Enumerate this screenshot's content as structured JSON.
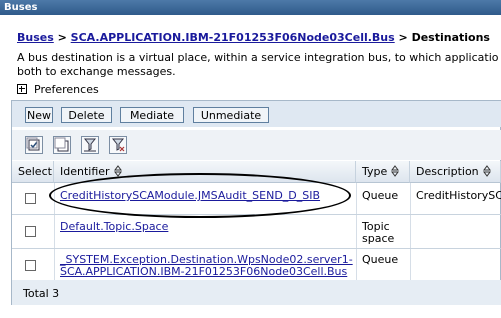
{
  "titlebar": {
    "title": "Buses"
  },
  "breadcrumb": {
    "link1": "Buses",
    "sep1": " > ",
    "link2": "SCA.APPLICATION.IBM-21F01253F06Node03Cell.Bus",
    "sep2": " > ",
    "current": "Destinations"
  },
  "description": {
    "line1": "A bus destination is a virtual place, within a service integration bus, to which applicatio",
    "line2": "both to exchange messages."
  },
  "preferences": {
    "label": "Preferences"
  },
  "toolbar": {
    "new_label": "New",
    "delete_label": "Delete",
    "mediate_label": "Mediate",
    "unmediate_label": "Unmediate"
  },
  "icons": [
    "select-all-icon",
    "deselect-all-icon",
    "show-filter-icon",
    "clear-filter-icon"
  ],
  "table": {
    "headers": {
      "select": "Select",
      "identifier": "Identifier",
      "type": "Type",
      "description": "Description"
    },
    "rows": [
      {
        "identifier": "CreditHistorySCAModule.JMSAudit_SEND_D_SIB",
        "type": "Queue",
        "description": "CreditHistorySC"
      },
      {
        "identifier": "Default.Topic.Space",
        "type_line1": "Topic",
        "type_line2": "space",
        "description": ""
      },
      {
        "identifier_line1": "_SYSTEM.Exception.Destination.WpsNode02.server1-",
        "identifier_line2": "SCA.APPLICATION.IBM-21F01253F06Node03Cell.Bus",
        "type": "Queue",
        "description": ""
      }
    ],
    "total": "Total 3"
  },
  "colors": {
    "titlebar": "#2f5a8a",
    "link": "#1a1a9c",
    "buttonbar": "#dfe8f2",
    "header": "#dde5ee",
    "annotation": "#000000"
  }
}
